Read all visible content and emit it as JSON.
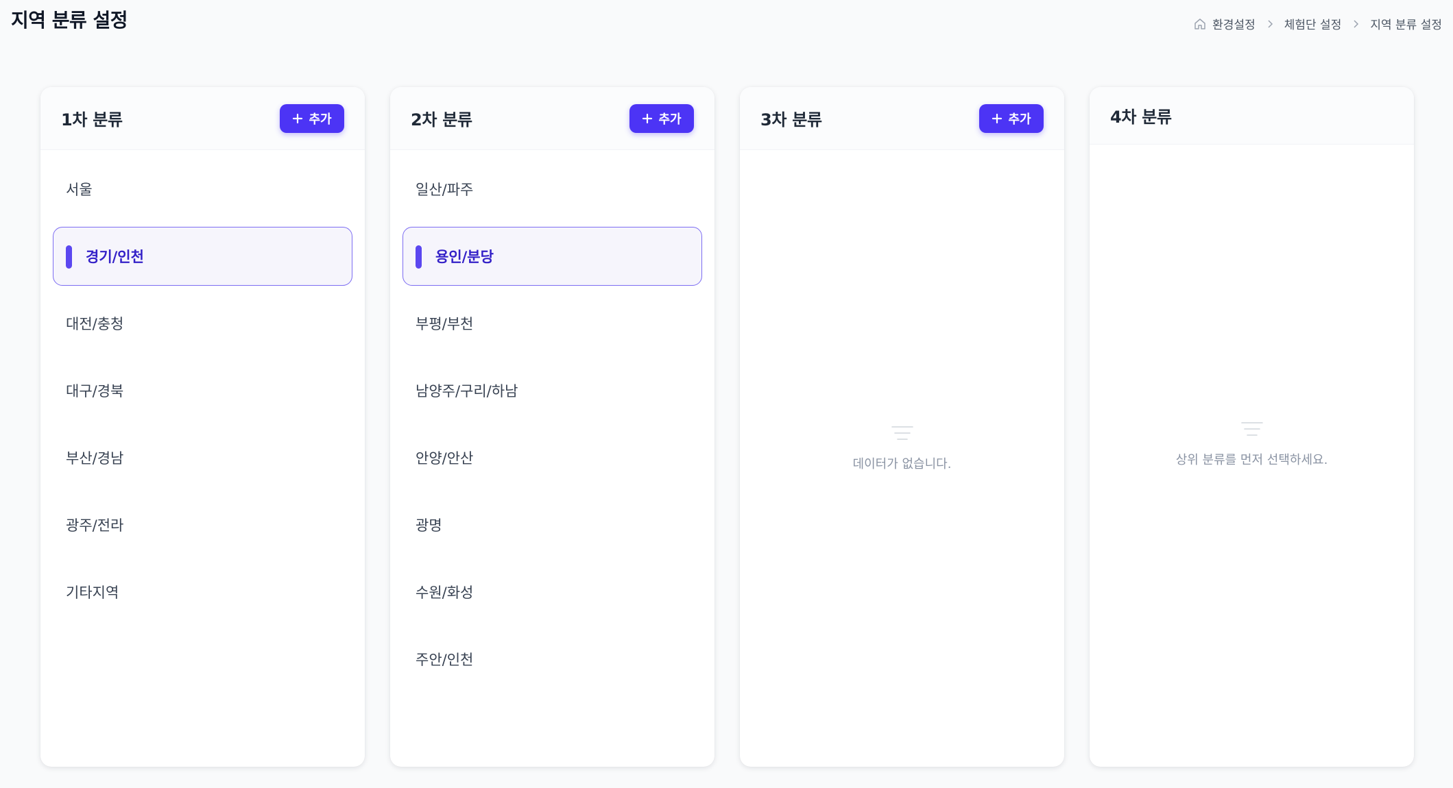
{
  "page": {
    "title": "지역 분류 설정"
  },
  "breadcrumb": {
    "items": [
      "환경설정",
      "체험단 설정",
      "지역 분류 설정"
    ]
  },
  "colors": {
    "accent": "#4c34f5",
    "selected_border": "#7c6cf2",
    "selected_text": "#3421c8"
  },
  "columns": [
    {
      "title": "1차 분류",
      "add_label": "추가",
      "items": [
        "서울",
        "경기/인천",
        "대전/충청",
        "대구/경북",
        "부산/경남",
        "광주/전라",
        "기타지역"
      ],
      "selected": "경기/인천"
    },
    {
      "title": "2차 분류",
      "add_label": "추가",
      "items": [
        "일산/파주",
        "용인/분당",
        "부평/부천",
        "남양주/구리/하남",
        "안양/안산",
        "광명",
        "수원/화성",
        "주안/인천"
      ],
      "selected": "용인/분당"
    },
    {
      "title": "3차 분류",
      "add_label": "추가",
      "items": [],
      "empty_text": "데이터가 없습니다."
    },
    {
      "title": "4차 분류",
      "items": [],
      "empty_text": "상위 분류를 먼저 선택하세요."
    }
  ]
}
